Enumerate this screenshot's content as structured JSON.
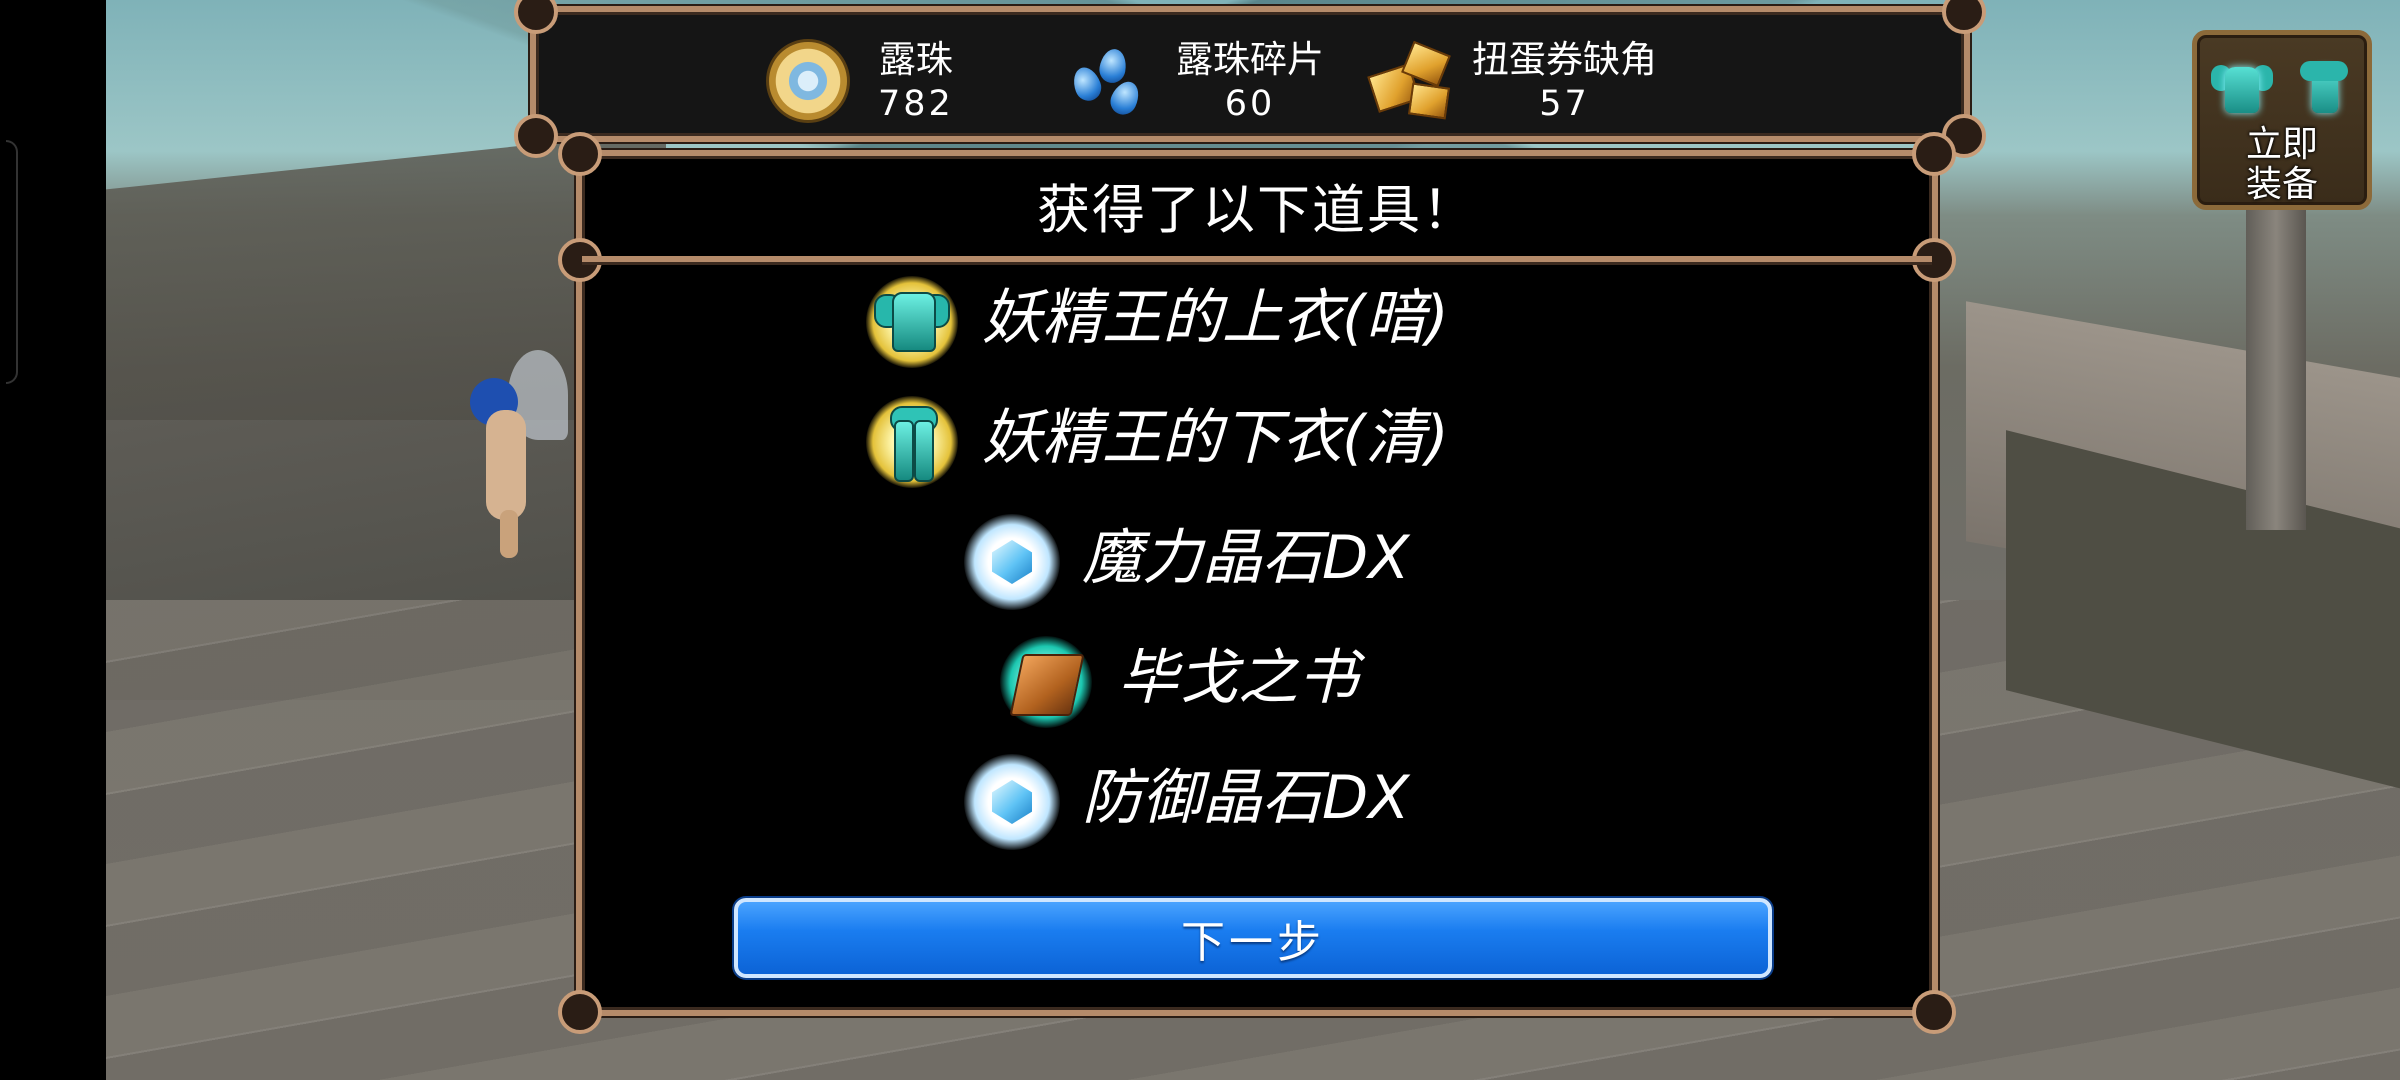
{
  "currencies": [
    {
      "name": "露珠",
      "amount": "782",
      "icon": "dew-orb-icon"
    },
    {
      "name": "露珠碎片",
      "amount": "60",
      "icon": "dew-shard-icon"
    },
    {
      "name": "扭蛋券缺角",
      "amount": "57",
      "icon": "gacha-ticket-fragment-icon"
    }
  ],
  "equip_button": {
    "label": "立即\n装备",
    "icon": "armor-set-icon"
  },
  "panel": {
    "title": "获得了以下道具！",
    "rewards": [
      {
        "name": "妖精王的上衣(暗)",
        "icon": "fairy-king-top-icon"
      },
      {
        "name": "妖精王的下衣(清)",
        "icon": "fairy-king-bottom-icon"
      },
      {
        "name": "魔力晶石DX",
        "icon": "magic-crystal-icon"
      },
      {
        "name": "毕戈之书",
        "icon": "book-icon"
      },
      {
        "name": "防御晶石DX",
        "icon": "defense-crystal-icon"
      }
    ],
    "next_label": "下一步"
  },
  "colors": {
    "frame": "#b58b6a",
    "next_button": "#1a7df0",
    "panel_bg": "#000000"
  }
}
